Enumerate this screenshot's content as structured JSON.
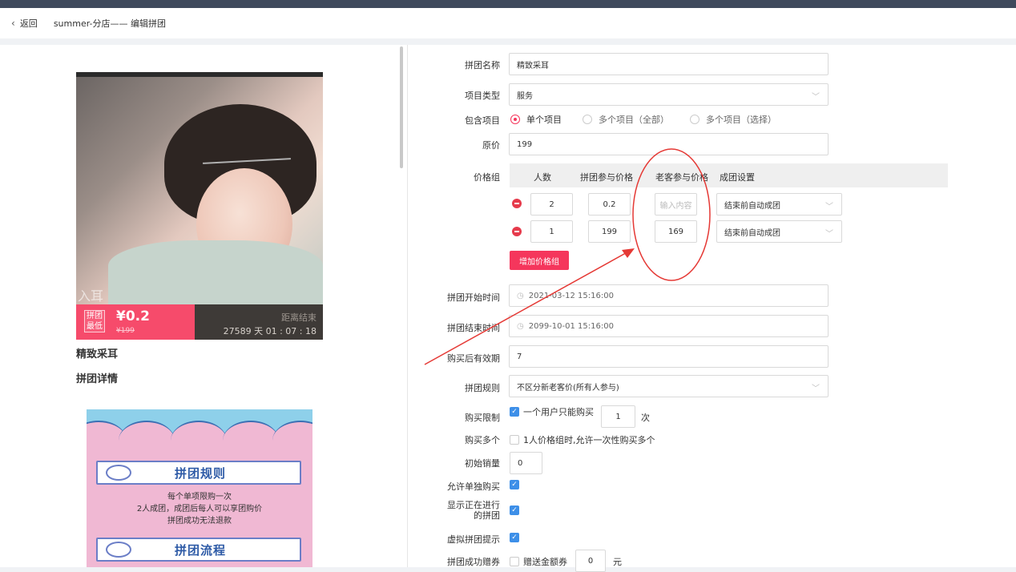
{
  "header": {
    "back_label": "返回",
    "title": "summer-分店—— 编辑拼团"
  },
  "preview": {
    "watermark": "入耳",
    "tag_line1": "拼团",
    "tag_line2": "最低",
    "price": "¥0.2",
    "old_price": "¥199",
    "end_label": "距离结束",
    "countdown": "27589 天 01 : 07 : 18",
    "product_title": "精致采耳",
    "detail_title": "拼团详情",
    "poster": {
      "rules_title": "拼团规则",
      "rules": [
        "每个单项限购一次",
        "2人成团，成团后每人可以享团购价",
        "拼团成功无法退款"
      ],
      "process_title": "拼团流程"
    }
  },
  "form": {
    "name": {
      "label": "拼团名称",
      "value": "精致采耳"
    },
    "type": {
      "label": "项目类型",
      "value": "服务"
    },
    "include": {
      "label": "包含项目",
      "options": [
        "单个项目",
        "多个项目（全部）",
        "多个项目（选择）"
      ],
      "selected": 0
    },
    "original_price": {
      "label": "原价",
      "value": "199"
    },
    "price_group": {
      "label": "价格组",
      "headers": [
        "人数",
        "拼团参与价格",
        "老客参与价格",
        "成团设置"
      ],
      "rows": [
        {
          "people": "2",
          "price": "0.2",
          "old_price": "",
          "old_price_placeholder": "输入内容",
          "setting": "结束前自动成团"
        },
        {
          "people": "1",
          "price": "199",
          "old_price": "169",
          "old_price_placeholder": "",
          "setting": "结束前自动成团"
        }
      ],
      "add_label": "增加价格组"
    },
    "start_time": {
      "label": "拼团开始时间",
      "value": "2021-03-12 15:16:00"
    },
    "end_time": {
      "label": "拼团结束时间",
      "value": "2099-10-01 15:16:00"
    },
    "validity": {
      "label": "购买后有效期",
      "value": "7"
    },
    "rule": {
      "label": "拼团规则",
      "value": "不区分新老客价(所有人参与)"
    },
    "limit": {
      "label": "购买限制",
      "text": "一个用户只能购买",
      "value": "1",
      "unit": "次",
      "checked": true
    },
    "multi": {
      "label": "购买多个",
      "text": "1人价格组时,允许一次性购买多个",
      "checked": false
    },
    "initial_sales": {
      "label": "初始销量",
      "value": "0"
    },
    "solo": {
      "label": "允许单独购买",
      "checked": true
    },
    "show_ongoing": {
      "label_line1": "显示正在进行",
      "label_line2": "的拼团",
      "checked": true
    },
    "virtual_tip": {
      "label": "虚拟拼团提示",
      "checked": true
    },
    "coupon": {
      "label": "拼团成功赠券",
      "text": "赠送金额券",
      "value": "0",
      "unit": "元",
      "checked": false
    }
  },
  "colors": {
    "accent": "#f5365c",
    "checkbox": "#3d8fe8",
    "annotation": "#e53935",
    "topbar": "#3f4a5c"
  }
}
